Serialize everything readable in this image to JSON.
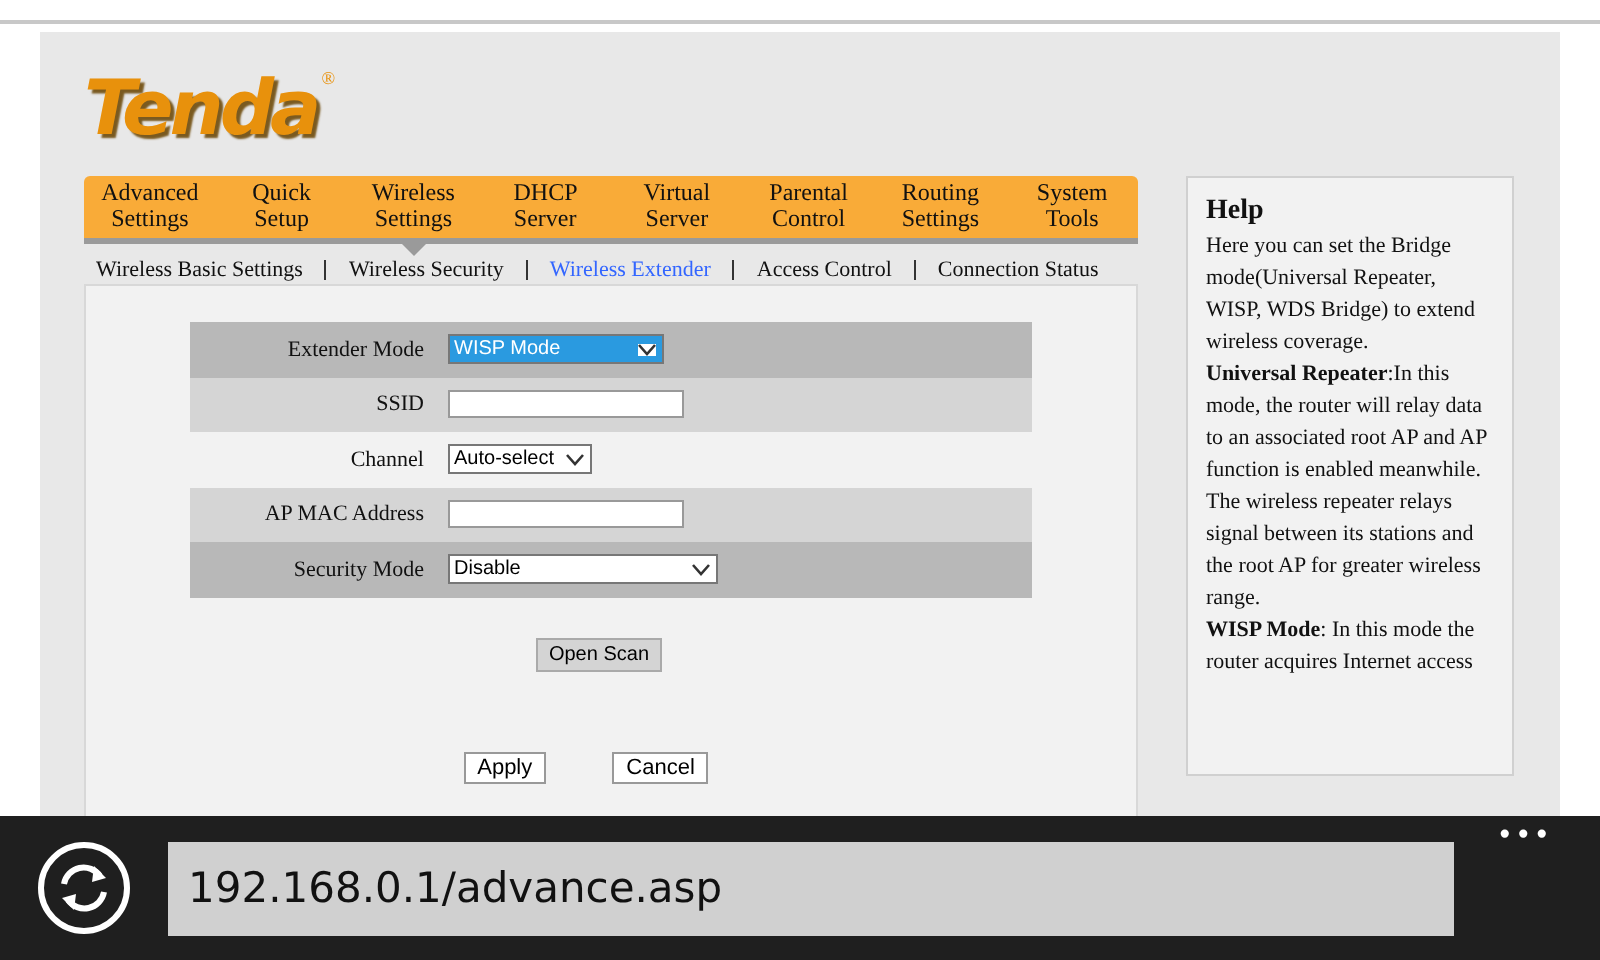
{
  "logo": {
    "text": "Tenda",
    "mark": "®"
  },
  "nav": [
    {
      "label": "Advanced Settings",
      "selected": false
    },
    {
      "label": "Quick Setup",
      "selected": false
    },
    {
      "label": "Wireless Settings",
      "selected": true
    },
    {
      "label": "DHCP Server",
      "selected": false
    },
    {
      "label": "Virtual Server",
      "selected": false
    },
    {
      "label": "Parental Control",
      "selected": false
    },
    {
      "label": "Routing Settings",
      "selected": false
    },
    {
      "label": "System Tools",
      "selected": false
    }
  ],
  "subnav": [
    {
      "label": "Wireless Basic Settings",
      "selected": false
    },
    {
      "label": "Wireless Security",
      "selected": false
    },
    {
      "label": "Wireless Extender",
      "selected": true
    },
    {
      "label": "Access Control",
      "selected": false
    },
    {
      "label": "Connection Status",
      "selected": false
    }
  ],
  "form": [
    {
      "label": "Extender Mode",
      "kind": "select",
      "value": "WISP Mode",
      "focused": true
    },
    {
      "label": "SSID",
      "kind": "input"
    },
    {
      "label": "Channel",
      "kind": "select",
      "value": "Auto-select",
      "focused": false
    },
    {
      "label": "AP MAC Address",
      "kind": "input"
    },
    {
      "label": "Security Mode",
      "kind": "select",
      "value": "Disable",
      "focused": false
    }
  ],
  "scan_button": "Open Scan",
  "buttons": [
    "Apply",
    "Cancel"
  ],
  "help": {
    "title": "Help",
    "paragraphs": [
      "Here you can set the Bridge mode(Universal Repeater, WISP,   WDS Bridge) to extend wireless coverage.",
      "**Universal Repeater**:In this mode, the router will relay data to an associated root AP and AP function is enabled meanwhile. The wireless repeater relays signal between its stations and the root AP for greater wireless range.",
      "**WISP Mode**: In this mode the router acquires Internet access"
    ]
  },
  "browser": {
    "url": "192.168.0.1/advance.asp",
    "menu": "•••"
  }
}
